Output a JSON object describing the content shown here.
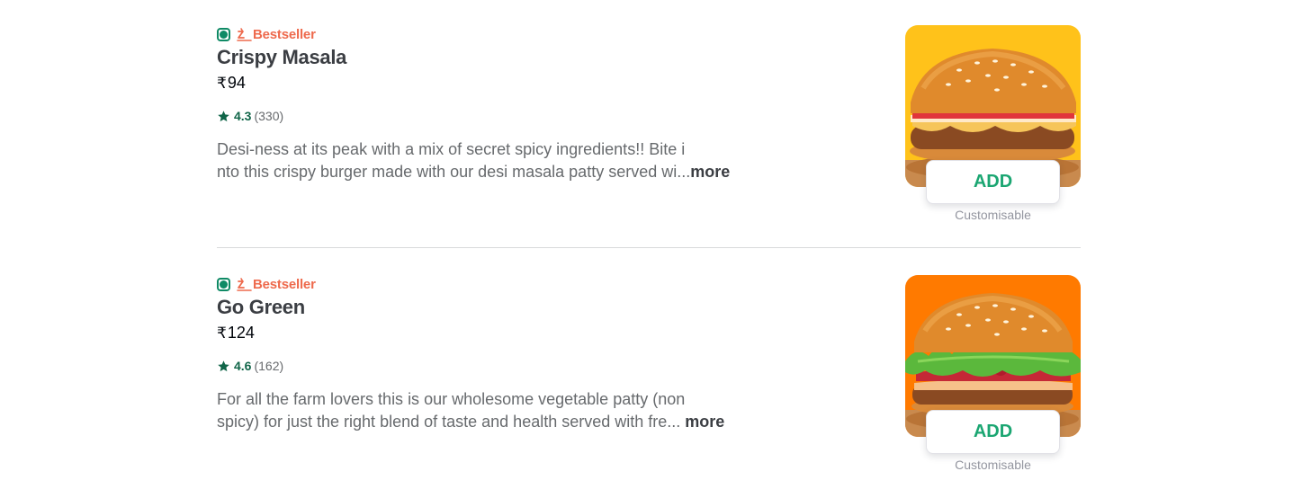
{
  "items": [
    {
      "badge_label": "Bestseller",
      "name": "Crispy Masala",
      "currency": "₹",
      "price": "94",
      "rating": "4.3",
      "rating_count": "(330)",
      "description_line1": "Desi-ness at its peak with a mix of secret spicy ingredients!! Bite i",
      "description_line2": "nto this crispy burger made with our desi masala patty served wi...",
      "more_label": "more",
      "add_label": "ADD",
      "customisable_label": "Customisable",
      "image_bg_color": "#ffc21a",
      "image_icon": "burger-masala-image"
    },
    {
      "badge_label": "Bestseller",
      "name": "Go Green",
      "currency": "₹",
      "price": "124",
      "rating": "4.6",
      "rating_count": "(162)",
      "description_line1": "For all the farm lovers this is our wholesome vegetable patty (non",
      "description_line2": "spicy) for just the right blend of taste and health served with fre... ",
      "more_label": "more",
      "add_label": "ADD",
      "customisable_label": "Customisable",
      "image_bg_color": "#ff7a00",
      "image_icon": "burger-green-image"
    }
  ],
  "colors": {
    "veg_green": "#0f8a65",
    "bestseller_orange": "#ee6a4d",
    "rating_green": "#116649",
    "add_green": "#1ba672"
  }
}
